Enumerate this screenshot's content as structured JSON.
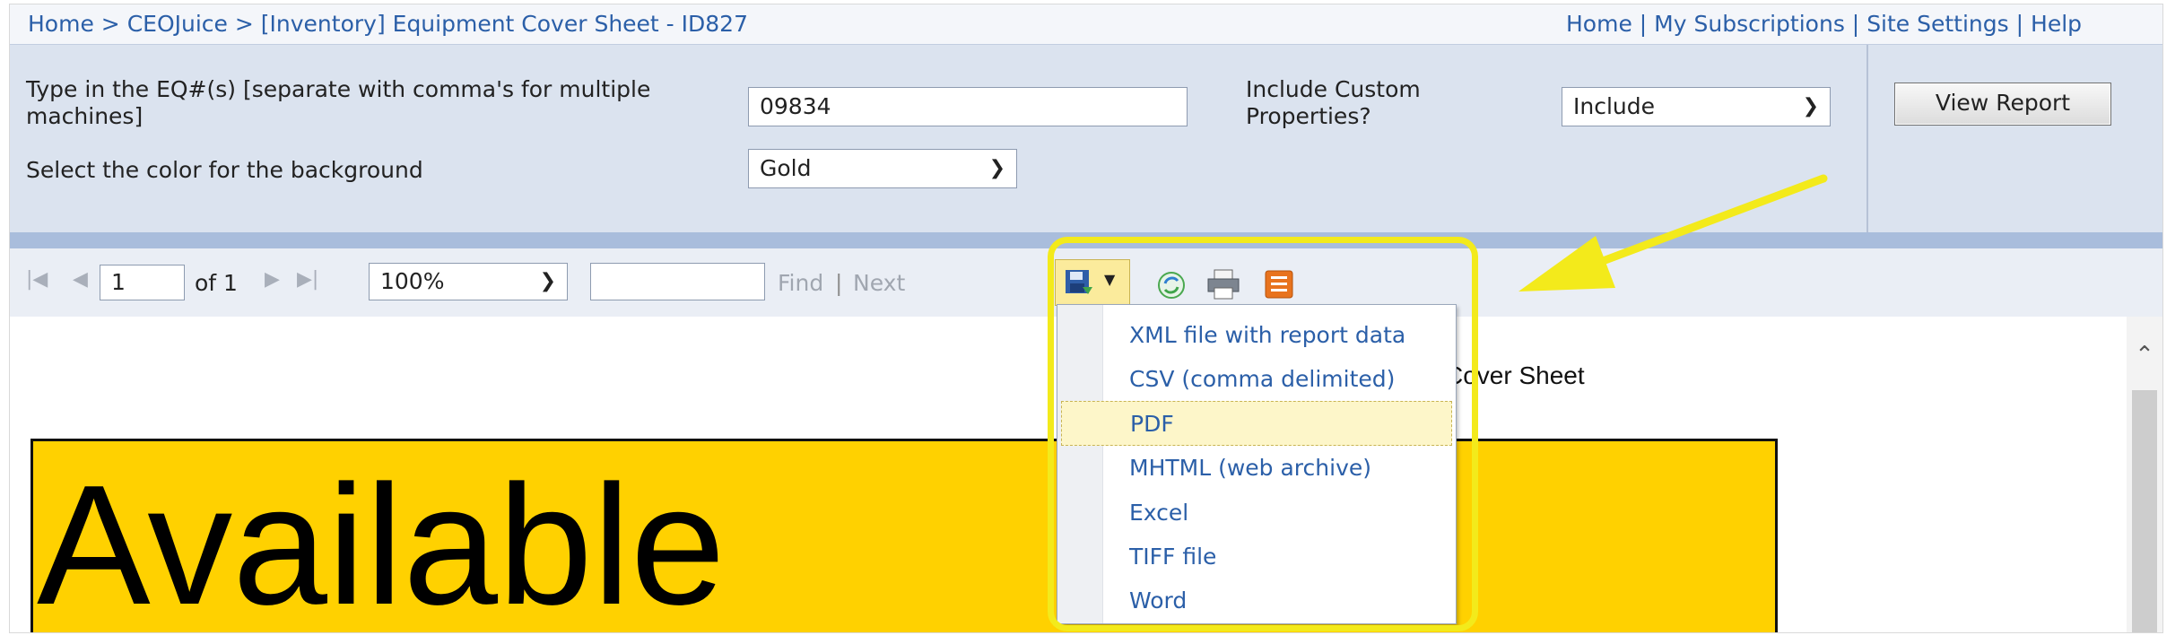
{
  "breadcrumb": {
    "items": [
      "Home",
      "CEOJuice",
      "[Inventory] Equipment Cover Sheet - ID827"
    ],
    "separator": ">"
  },
  "top_links": [
    "Home",
    "My Subscriptions",
    "Site Settings",
    "Help"
  ],
  "top_link_separator": "|",
  "params": {
    "eq_label": "Type in the EQ#(s) [separate with comma's for multiple machines]",
    "eq_value": "09834",
    "custom_label": "Include Custom Properties?",
    "custom_value": "Include",
    "color_label": "Select the color for the background",
    "color_value": "Gold",
    "view_button": "View Report"
  },
  "toolbar": {
    "page_value": "1",
    "of_text": "of 1",
    "zoom_value": "100%",
    "find_label": "Find",
    "find_separator": "|",
    "next_label": "Next",
    "icons": [
      "first-page-icon",
      "previous-page-icon",
      "next-page-icon",
      "last-page-icon",
      "export-save-icon",
      "refresh-icon",
      "print-icon",
      "data-feed-icon"
    ]
  },
  "export_menu": {
    "items": [
      "XML file with report data",
      "CSV (comma delimited)",
      "PDF",
      "MHTML (web archive)",
      "Excel",
      "TIFF file",
      "Word"
    ],
    "highlighted": "PDF"
  },
  "report": {
    "title_fragment": "Cover Sheet",
    "available_text": "Available",
    "background_color": "#ffd100"
  },
  "annotation": {
    "color": "#f3ea1b"
  }
}
